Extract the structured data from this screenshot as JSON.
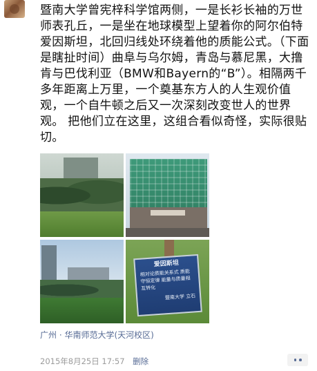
{
  "post": {
    "text": "暨南大学曾宪梓科学馆两侧，一是长衫长袖的万世师表孔丘，一是坐在地球模型上望着你的阿尔伯特 爱因斯坦，北回归线处环绕着他的质能公式。（下面是瞎扯时间）曲阜与乌尔姆，青岛与慕尼黑，大撸肯与巴伐利亚（BMW和Bayern的“B”）。相隔两千多年距离上万里，一个奠基东方人的人生观价值观，一个自牛顿之后又一次深刻改变世人的世界观。 把他们立在这里，这组合看似奇怪，实际很贴切。",
    "location": "广州 · 华南师范大学(天河校区)",
    "timestamp": "2015年8月25日 17:57",
    "delete_label": "删除",
    "sign_title": "爱因斯坦",
    "sign_body": "相对论质能关系式 质能守恒定律 能量与质量相互转化",
    "sign_footer": "暨南大学  立石"
  },
  "colors": {
    "link": "#576b95",
    "meta": "#9b9b9b",
    "text": "#111111"
  }
}
